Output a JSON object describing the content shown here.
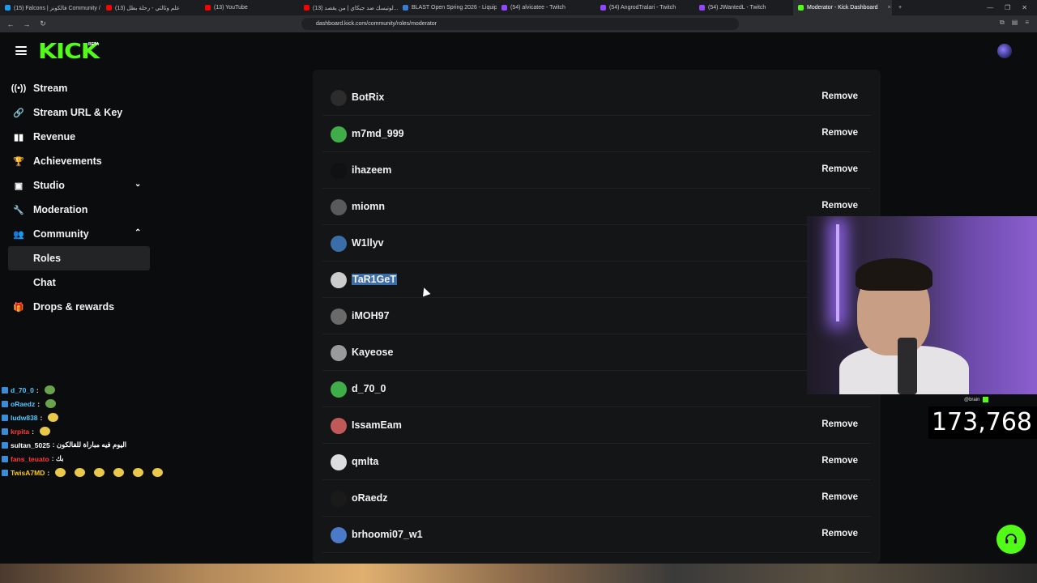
{
  "browser": {
    "tabs": [
      {
        "title": "(15) Falcons | فالكونز Community / X",
        "color": "#1d9bf0"
      },
      {
        "title": "(13) علم وثالثي - رحلة بطل",
        "color": "#ff0000"
      },
      {
        "title": "(13) YouTube",
        "color": "#ff0000"
      },
      {
        "title": "(13) لوتيسك ضد جيكاي | من يقصد...",
        "color": "#ff0000"
      },
      {
        "title": "BLAST Open Spring 2026 - Liquipedia",
        "color": "#3a7bd5"
      },
      {
        "title": "(54) alvicatee - Twitch",
        "color": "#9146ff"
      },
      {
        "title": "(54) AngrodTralari - Twitch",
        "color": "#9146ff"
      },
      {
        "title": "(54) JWantedL - Twitch",
        "color": "#9146ff"
      },
      {
        "title": "Moderator - Kick Dashboard",
        "color": "#53fc18"
      }
    ],
    "close_label": "×",
    "new_tab_label": "+",
    "url": "dashboard.kick.com/community/roles/moderator"
  },
  "app": {
    "logo": "KICK",
    "beta": "BETA",
    "accent": "#53fc18"
  },
  "sidebar": {
    "items": [
      {
        "label": "Stream",
        "icon": "broadcast-icon",
        "glyph": "((•))"
      },
      {
        "label": "Stream URL & Key",
        "icon": "link-icon",
        "glyph": "🔗"
      },
      {
        "label": "Revenue",
        "icon": "chart-icon",
        "glyph": "▮▮"
      },
      {
        "label": "Achievements",
        "icon": "trophy-icon",
        "glyph": "🏆"
      },
      {
        "label": "Studio",
        "icon": "studio-icon",
        "glyph": "▣",
        "chevron": "⌄"
      },
      {
        "label": "Moderation",
        "icon": "wrench-icon",
        "glyph": "🔧"
      },
      {
        "label": "Community",
        "icon": "people-icon",
        "glyph": "👥",
        "chevron": "⌃"
      }
    ],
    "subitems": [
      {
        "label": "Roles",
        "selected": true
      },
      {
        "label": "Chat",
        "selected": false
      }
    ],
    "after": {
      "label": "Drops & rewards",
      "icon": "gift-icon",
      "glyph": "🎁"
    }
  },
  "chat": [
    {
      "user": "d_70_0",
      "user_color": "#53c8ff",
      "msg": ":",
      "emotes": 1,
      "emote_color": "green"
    },
    {
      "user": "oRaedz",
      "user_color": "#53c8ff",
      "msg": ":",
      "emotes": 1,
      "emote_color": "green"
    },
    {
      "user": "ludw838",
      "user_color": "#53c8ff",
      "msg": ":",
      "emotes": 1,
      "emote_color": "yellow"
    },
    {
      "user": "krpita",
      "user_color": "#ff3b3b",
      "msg": ":",
      "emotes": 1,
      "emote_color": "yellow"
    },
    {
      "user": "sultan_5025",
      "user_color": "#ffffff",
      "msg": ": اليوم فيه مباراة للفالكون",
      "emotes": 0
    },
    {
      "user": "fans_teuato",
      "user_color": "#ff3b3b",
      "msg": ": بك",
      "emotes": 0
    },
    {
      "user": "TwisA7MD",
      "user_color": "#ffcc00",
      "msg": ":",
      "emotes": 6,
      "emote_color": "yellow"
    }
  ],
  "moderators": {
    "remove_label": "Remove",
    "rows": [
      {
        "name": "BotRix",
        "avatar": "#2c2c2c",
        "remove": true,
        "highlight": false
      },
      {
        "name": "m7md_999",
        "avatar": "#3fae49",
        "remove": true,
        "highlight": false
      },
      {
        "name": "ihazeem",
        "avatar": "#111111",
        "remove": true,
        "highlight": false
      },
      {
        "name": "miomn",
        "avatar": "#5a5a5a",
        "remove": true,
        "highlight": false
      },
      {
        "name": "W1llyv",
        "avatar": "#3a6ea8",
        "remove": false,
        "highlight": false
      },
      {
        "name": "TaR1GeT",
        "avatar": "#cccccc",
        "remove": false,
        "highlight": true
      },
      {
        "name": "iMOH97",
        "avatar": "#6a6a6a",
        "remove": false,
        "highlight": false
      },
      {
        "name": "Kayeose",
        "avatar": "#9a9a9a",
        "remove": false,
        "highlight": false
      },
      {
        "name": "d_70_0",
        "avatar": "#3fae49",
        "remove": false,
        "highlight": false
      },
      {
        "name": "IssamEam",
        "avatar": "#c05a5a",
        "remove": true,
        "highlight": false
      },
      {
        "name": "qmlta",
        "avatar": "#dddddd",
        "remove": true,
        "highlight": false
      },
      {
        "name": "oRaedz",
        "avatar": "#1a1a1a",
        "remove": true,
        "highlight": false
      },
      {
        "name": "brhoomi07_w1",
        "avatar": "#4a7ac8",
        "remove": true,
        "highlight": false
      }
    ]
  },
  "overlay": {
    "cam_tag": "@brain",
    "viewer_count": "173,768"
  }
}
